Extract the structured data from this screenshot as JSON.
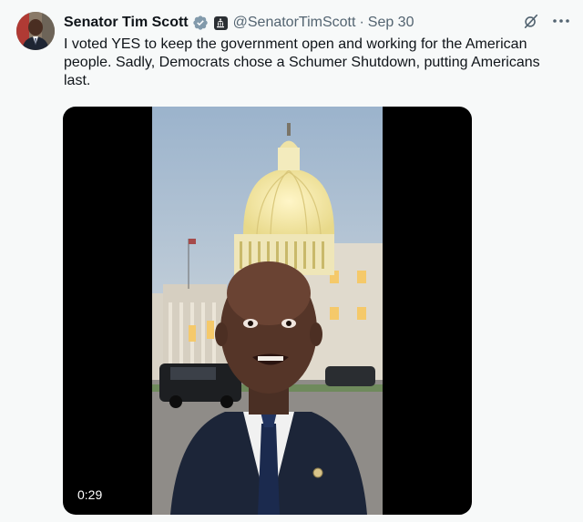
{
  "author": {
    "display_name": "Senator Tim Scott",
    "handle": "@SenatorTimScott",
    "separator": "·",
    "timestamp": "Sep 30",
    "verified_color": "#829aab"
  },
  "icons": {
    "verified": "verified-badge-icon",
    "gov": "government-badge-icon",
    "grok": "grok-icon",
    "more": "more-options-icon"
  },
  "tweet": {
    "text": "I voted YES to keep the government open and working for the American people. Sadly, Democrats chose a Schumer Shutdown, putting Americans last."
  },
  "media": {
    "type": "video",
    "duration": "0:29"
  }
}
